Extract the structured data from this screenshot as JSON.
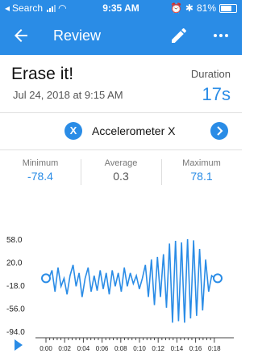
{
  "status_bar": {
    "carrier": "Search",
    "time": "9:35 AM",
    "battery": "81%",
    "battery_level": 0.81
  },
  "app_bar": {
    "title": "Review",
    "back_icon": "back-arrow-icon",
    "edit_icon": "pencil-icon",
    "more_icon": "more-dots-icon"
  },
  "run": {
    "title": "Erase it!",
    "date": "Jul 24, 2018 at 9:15 AM",
    "duration_label": "Duration",
    "duration_value": "17s"
  },
  "sensor": {
    "name": "Accelerometer X",
    "icon_letter": "X",
    "next_icon": "chevron-right-icon"
  },
  "stats": {
    "minimum_label": "Minimum",
    "minimum_value": "-78.4",
    "average_label": "Average",
    "average_value": "0.3",
    "maximum_label": "Maximum",
    "maximum_value": "78.1"
  },
  "colors": {
    "accent": "#2a8ce6"
  },
  "chart_data": {
    "type": "line",
    "y_ticks": [
      "58.0",
      "20.0",
      "-18.0",
      "-56.0",
      "-94.0"
    ],
    "x_ticks": [
      "0:00",
      "0:02",
      "0:04",
      "0:06",
      "0:08",
      "0:10",
      "0:12",
      "0:14",
      "0:16",
      "0:18"
    ],
    "ylim": [
      -94,
      78.1
    ],
    "series": [
      {
        "values": [
          5,
          5,
          20,
          -20,
          25,
          -10,
          5,
          -25,
          10,
          30,
          -10,
          15,
          -30,
          5,
          25,
          -20,
          10,
          -18,
          20,
          -15,
          15,
          -25,
          20,
          -10,
          15,
          -20,
          25,
          -10,
          15,
          -5,
          10,
          -15,
          5,
          30,
          -30,
          40,
          -45,
          45,
          -30,
          50,
          -50,
          70,
          -78,
          75,
          -75,
          72,
          -78,
          78,
          -70,
          76,
          -65,
          60,
          -55,
          40,
          -20,
          10,
          5,
          5
        ]
      }
    ]
  }
}
